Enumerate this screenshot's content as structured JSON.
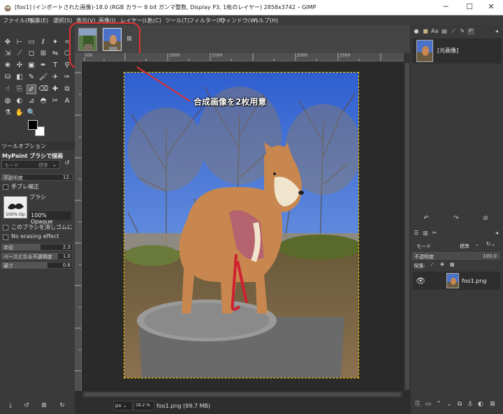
{
  "window": {
    "title": "[foo1] (インポートされた画像)-18.0 (RGB カラー 8 bit ガンマ整数, Display P3, 1枚のレイヤー) 2858x3742 – GIMP",
    "minimize": "─",
    "maximize": "☐",
    "close": "✕"
  },
  "menu": [
    "ファイル(F)",
    "編集(E)",
    "選択(S)",
    "表示(V)",
    "画像(I)",
    "レイヤー(L)",
    "色(C)",
    "ツール(T)",
    "フィルター(R)",
    "ウィンドウ(W)",
    "ヘルプ(H)"
  ],
  "tool_options": {
    "tab": "ツールオプション",
    "title": "MyPaint ブラシで描画",
    "mode_label": "モード",
    "mode_value": "標準",
    "opacity_label": "不透明度",
    "opacity_value": "12.",
    "hand_shake_label": "手ブレ補正",
    "brush_label": "ブラシ",
    "brush_preview_label": "100% Op",
    "brush_name": "100% Opaque",
    "eraser_label": "このブラシを消しゴムに使う",
    "no_erasing_label": "No erasing effect",
    "radius_label": "半径",
    "radius_value": "2.3",
    "base_opacity_label": "ベースとなる不透明度",
    "base_opacity_value": "1.0",
    "hardness_label": "硬さ",
    "hardness_value": "0.6"
  },
  "annotation": {
    "text": "合成画像を2枚用意"
  },
  "ruler": {
    "ticks": [
      "500",
      "1000",
      "1500",
      "2000",
      "2500"
    ]
  },
  "status": {
    "unit": "px",
    "zoom": "18.2 %",
    "info": "foo1.png (99.7 MB)"
  },
  "history": {
    "item_label": "[元画像]"
  },
  "layers": {
    "mode_label": "モード",
    "mode_value": "標準",
    "opacity_label": "不透明度",
    "opacity_value": "100.0",
    "lock_label": "保護:",
    "layer_name": "foo1.png"
  },
  "colors": {
    "annotation_red": "#e03030",
    "selection_border": "#ffd400",
    "sky": "#3c6fd6"
  }
}
